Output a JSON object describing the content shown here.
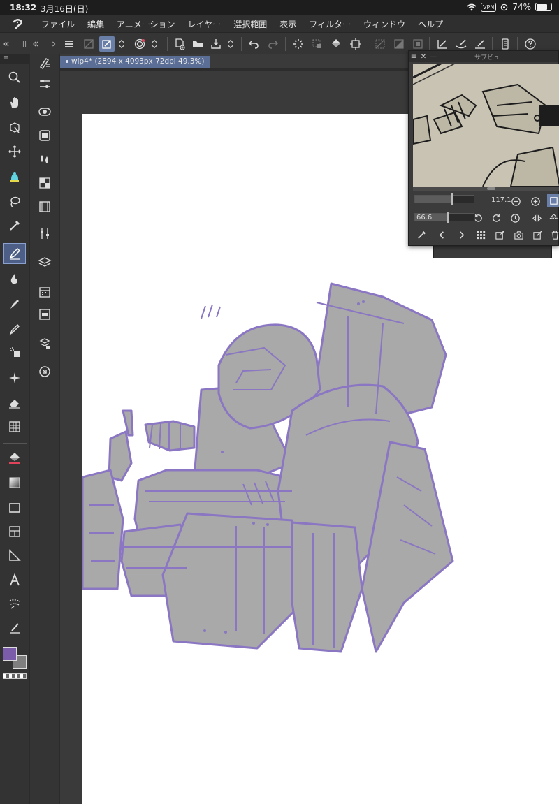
{
  "status_bar": {
    "time": "18:32",
    "date": "3月16日(日)",
    "vpn": "VPN",
    "battery": "74%",
    "battery_level": 0.74
  },
  "menu": {
    "items": [
      "ファイル",
      "編集",
      "アニメーション",
      "レイヤー",
      "選択範囲",
      "表示",
      "フィルター",
      "ウィンドウ",
      "ヘルプ"
    ]
  },
  "document": {
    "tab_label": "wip4* (2894 x 4093px 72dpi 49.3%)"
  },
  "subview": {
    "title": "サブビュー",
    "zoom_value": "117.1",
    "rotate_value": "66.6"
  },
  "colors": {
    "main": "#7a5cab",
    "sub": "#7f7f7f",
    "line": "#8a76c2",
    "fill": "#a9a9a9",
    "accent": "#6a7fa8"
  }
}
